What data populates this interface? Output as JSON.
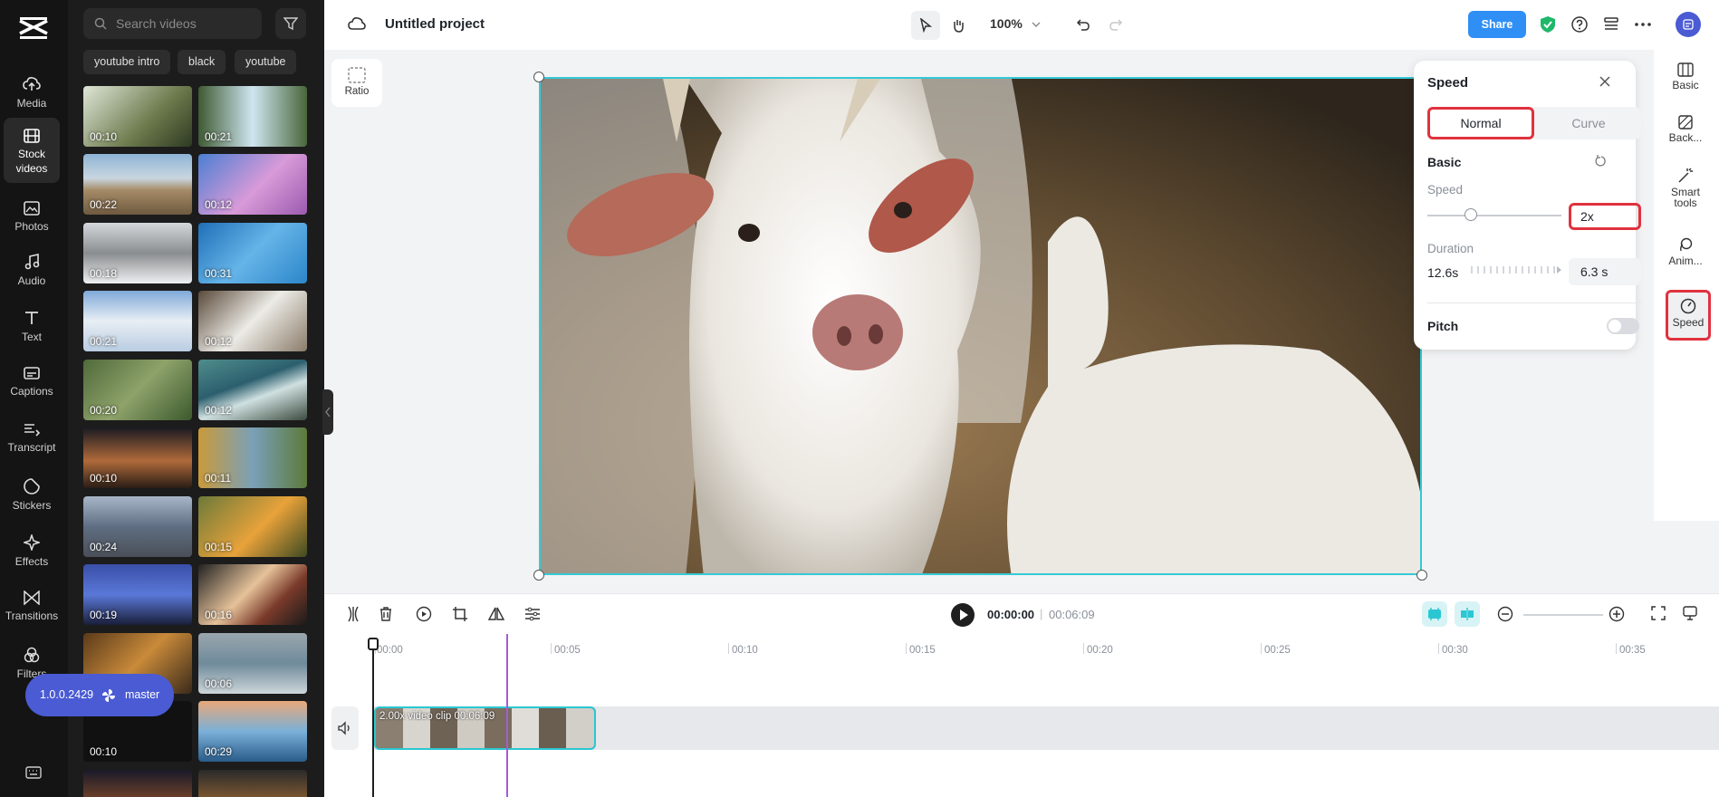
{
  "app": {
    "project_title": "Untitled project",
    "zoom": "100%",
    "share_label": "Share"
  },
  "rail": {
    "items": [
      {
        "label": "Media",
        "icon": "cloud-upload-icon"
      },
      {
        "label": "Stock videos",
        "icon": "film-icon"
      },
      {
        "label": "Photos",
        "icon": "image-icon"
      },
      {
        "label": "Audio",
        "icon": "music-note-icon"
      },
      {
        "label": "Text",
        "icon": "text-t-icon"
      },
      {
        "label": "Captions",
        "icon": "captions-icon"
      },
      {
        "label": "Transcript",
        "icon": "transcript-icon"
      },
      {
        "label": "Stickers",
        "icon": "sticker-icon"
      },
      {
        "label": "Effects",
        "icon": "sparkle-icon"
      },
      {
        "label": "Transitions",
        "icon": "transition-icon"
      },
      {
        "label": "Filters",
        "icon": "filter-icon"
      }
    ],
    "active": "Stock videos"
  },
  "panel": {
    "search_placeholder": "Search videos",
    "chips": [
      "youtube intro",
      "black",
      "youtube"
    ],
    "durations": [
      "00:10",
      "00:21",
      "00:22",
      "00:12",
      "00:18",
      "00:31",
      "00:21",
      "00:12",
      "00:20",
      "00:12",
      "00:10",
      "00:11",
      "00:24",
      "00:15",
      "00:19",
      "00:16",
      "",
      "00:06",
      "00:10",
      "00:29"
    ]
  },
  "version": {
    "number": "1.0.0.2429",
    "branch": "master"
  },
  "canvas": {
    "ratio_label": "Ratio"
  },
  "speed_panel": {
    "title": "Speed",
    "tab_normal": "Normal",
    "tab_curve": "Curve",
    "section_basic": "Basic",
    "speed_label": "Speed",
    "speed_value": "2x",
    "duration_label": "Duration",
    "duration_original": "12.6s",
    "duration_value": "6.3 s",
    "pitch_label": "Pitch",
    "pitch_enabled": false
  },
  "right_tabs": [
    {
      "label": "Basic",
      "icon": "basic-layout-icon"
    },
    {
      "label": "Back...",
      "icon": "background-icon"
    },
    {
      "label": "Smart tools",
      "icon": "magic-wand-icon"
    },
    {
      "label": "Anim...",
      "icon": "animation-icon"
    },
    {
      "label": "Speed",
      "icon": "speedometer-icon"
    }
  ],
  "playback": {
    "current": "00:00:00",
    "separator": "|",
    "total": "00:06:09"
  },
  "timeline": {
    "ticks": [
      "00:00",
      "00:05",
      "00:10",
      "00:15",
      "00:20",
      "00:25",
      "00:30",
      "00:35"
    ],
    "clip_label": "2.00x   video clip   00:06:09"
  },
  "colors": {
    "accent": "#2f8ff5",
    "selection": "#35c9d6",
    "highlight": "#e0323e",
    "version_pill": "#4a5bd4"
  }
}
